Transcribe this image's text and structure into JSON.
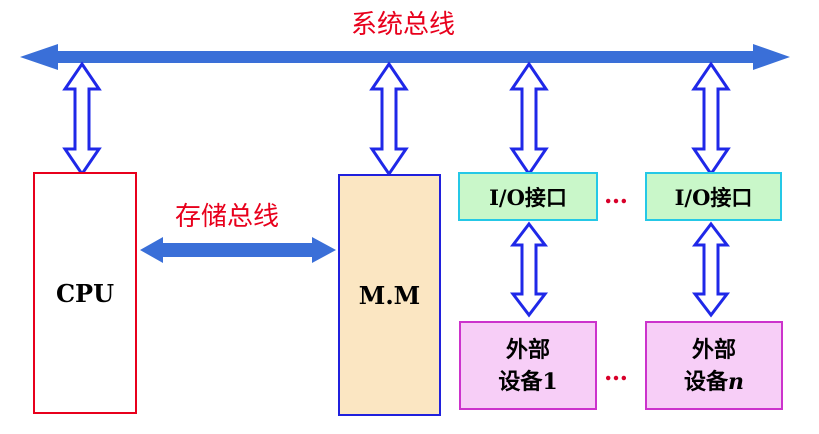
{
  "system_bus_label": "系统总线",
  "memory_bus_label": "存储总线",
  "cpu_label": "CPU",
  "mm_label": "M.M",
  "io_interface_1_label": "I/O接口",
  "io_interface_n_label": "I/O接口",
  "device_1": {
    "line1": "外部",
    "line2_prefix": "设备",
    "line2_suffix": "1"
  },
  "device_n": {
    "line1": "外部",
    "line2_prefix": "设备",
    "line2_suffix": "n"
  },
  "ellipsis_top": "…",
  "ellipsis_bottom": "…",
  "colors": {
    "bus_blue": "#3a6fd8",
    "arrow_outline": "#1f28e8",
    "label_red": "#e8001c",
    "cpu_border": "#e8001c",
    "mm_fill": "#fbe6c2",
    "mm_border": "#2020dd",
    "io_fill": "#c9f7c9",
    "io_border": "#25c8e6",
    "device_fill": "#f7cef7",
    "device_border": "#cc33cc"
  }
}
